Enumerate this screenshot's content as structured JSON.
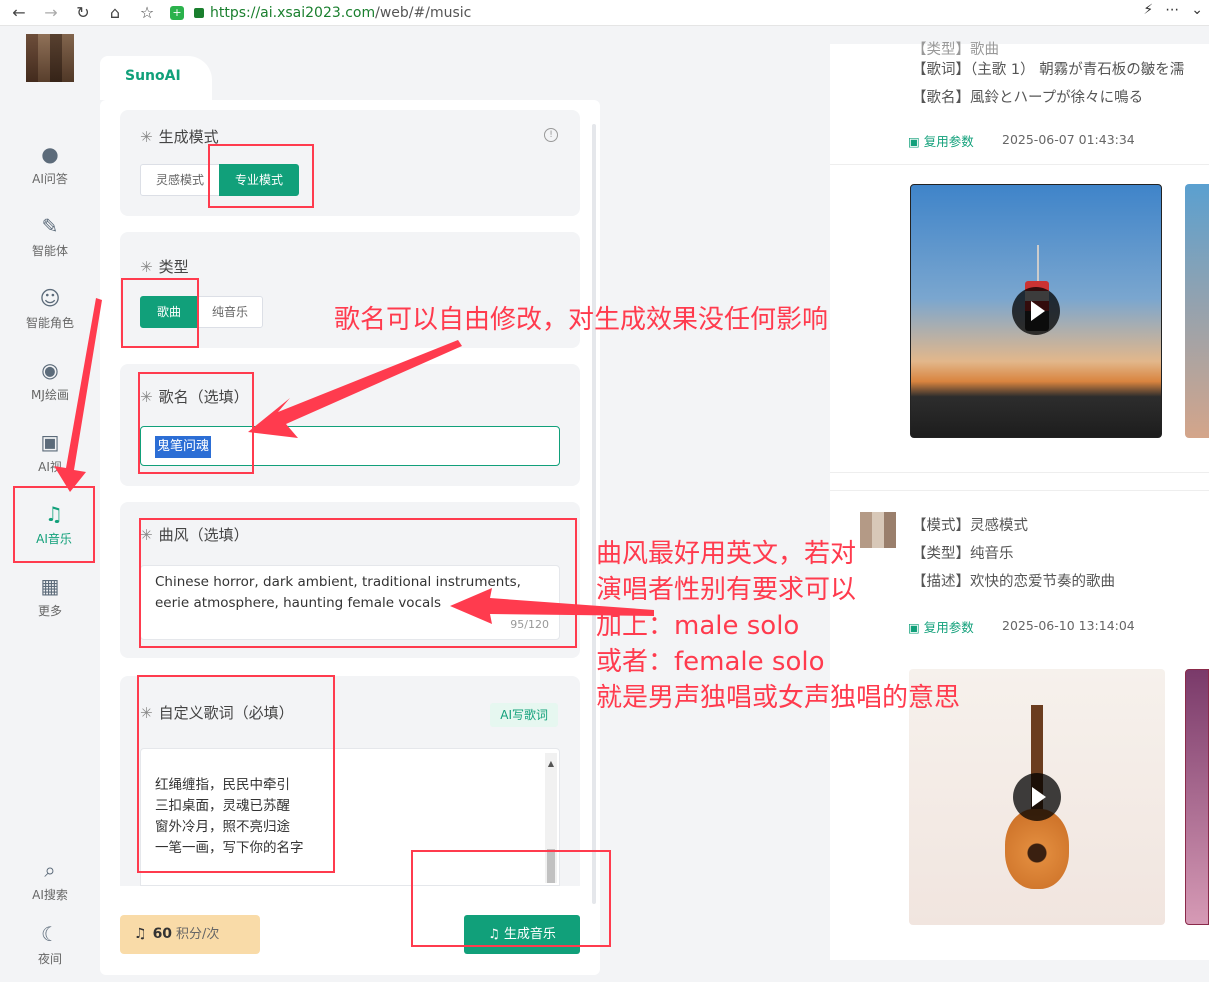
{
  "browser": {
    "url_host": "https://ai.xsai2023.com",
    "url_path": "/web/#/music"
  },
  "sidebar": {
    "items": [
      {
        "label": "AI问答",
        "icon": "chat-icon"
      },
      {
        "label": "智能体",
        "icon": "feather-icon"
      },
      {
        "label": "智能角色",
        "icon": "head-icon"
      },
      {
        "label": "MJ绘画",
        "icon": "palette-icon"
      },
      {
        "label": "AI视",
        "icon": "video-icon"
      },
      {
        "label": "AI音乐",
        "icon": "music-note-icon"
      },
      {
        "label": "更多",
        "icon": "grid-icon"
      },
      {
        "label": "AI搜索",
        "icon": "search-icon"
      },
      {
        "label": "夜间",
        "icon": "moon-icon"
      }
    ]
  },
  "panel": {
    "tab": "SunoAI",
    "mode": {
      "label": "生成模式",
      "options": [
        "灵感模式",
        "专业模式"
      ],
      "selected": "专业模式"
    },
    "type": {
      "label": "类型",
      "options": [
        "歌曲",
        "纯音乐"
      ],
      "selected": "歌曲"
    },
    "song_name": {
      "label": "歌名（选填）",
      "value": "鬼笔问魂"
    },
    "style": {
      "label": "曲风（选填）",
      "value_line1": "Chinese horror, dark ambient, traditional instruments,",
      "value_line2": "eerie atmosphere, haunting female vocals",
      "counter": "95/120"
    },
    "lyrics": {
      "label": "自定义歌词（必填）",
      "ai_button": "AI写歌词",
      "lines": [
        "红绳缠指，民民中牵引",
        "三扣桌面，灵魂已苏醒",
        "窗外冷月，照不亮归途",
        "一笔一画，写下你的名字"
      ]
    },
    "points": {
      "value": "60",
      "unit": "积分/次"
    },
    "generate_button": "生成音乐"
  },
  "history": {
    "item1": {
      "lyrics_line": "【歌词】（主歌 1） 朝霧が青石板の皺を濡",
      "name_line": "【歌名】風鈴とハープが徐々に鳴る",
      "reuse": "复用参数",
      "date": "2025-06-07 01:43:34"
    },
    "item2": {
      "mode_line": "【模式】灵感模式",
      "type_line": "【类型】纯音乐",
      "desc_line": "【描述】欢快的恋爱节奏的歌曲",
      "reuse": "复用参数",
      "date": "2025-06-10 13:14:04"
    }
  },
  "annotations": {
    "song_name_note": "歌名可以自由修改，对生成效果没任何影响",
    "style_note_lines": [
      "曲风最好用英文，若对",
      "演唱者性别有要求可以",
      "加上：male solo",
      "或者：female solo",
      "就是男声独唱或女声独唱的意思"
    ]
  },
  "colors": {
    "accent": "#11a07a",
    "annotation": "#ff3b4e"
  }
}
